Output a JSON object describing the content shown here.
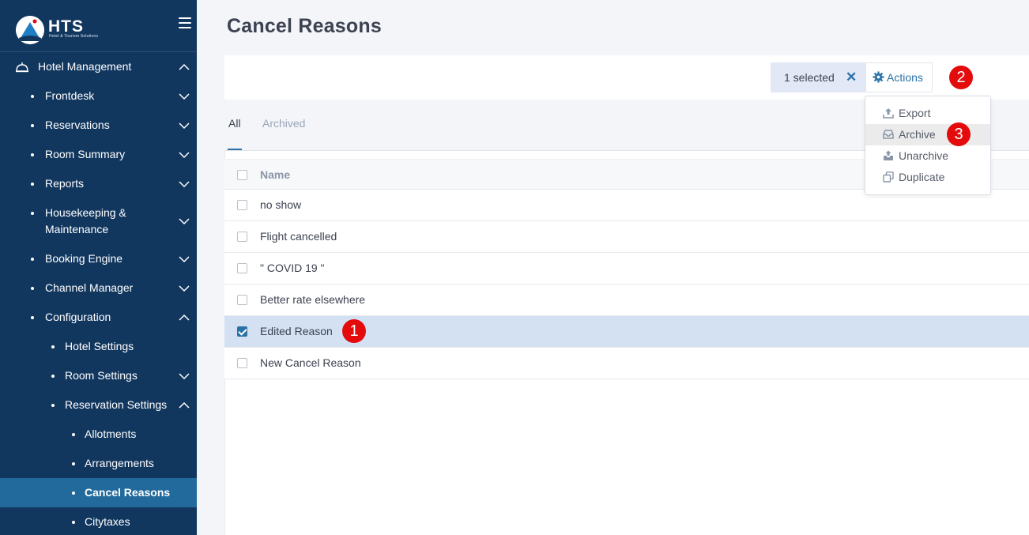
{
  "sidebar": {
    "brand": "HTS",
    "brand_sub": "Hotel & Tourism Solutions",
    "items": [
      {
        "label": "Hotel Management"
      },
      {
        "label": "Frontdesk"
      },
      {
        "label": "Reservations"
      },
      {
        "label": "Room Summary"
      },
      {
        "label": "Reports"
      },
      {
        "label": "Housekeeping &"
      },
      {
        "label": "Maintenance"
      },
      {
        "label": "Booking Engine"
      },
      {
        "label": "Channel Manager"
      },
      {
        "label": "Configuration"
      },
      {
        "label": "Hotel Settings"
      },
      {
        "label": "Room Settings"
      },
      {
        "label": "Reservation Settings"
      },
      {
        "label": "Allotments"
      },
      {
        "label": "Arrangements"
      },
      {
        "label": "Cancel Reasons"
      },
      {
        "label": "Citytaxes"
      }
    ]
  },
  "page": {
    "title": "Cancel Reasons"
  },
  "toolbar": {
    "selected_label": "1 selected",
    "clear_glyph": "✕",
    "actions_label": "Actions"
  },
  "tabs": [
    {
      "label": "All"
    },
    {
      "label": "Archived"
    }
  ],
  "table": {
    "header_name": "Name",
    "rows": [
      {
        "name": "no show"
      },
      {
        "name": "Flight cancelled"
      },
      {
        "name": "\" COVID 19 \""
      },
      {
        "name": "Better rate elsewhere"
      },
      {
        "name": "Edited Reason"
      },
      {
        "name": "New Cancel Reason"
      }
    ]
  },
  "actions_menu": [
    {
      "label": "Export",
      "icon": "upload-icon"
    },
    {
      "label": "Archive",
      "icon": "inbox-icon"
    },
    {
      "label": "Unarchive",
      "icon": "unarchive-icon"
    },
    {
      "label": "Duplicate",
      "icon": "duplicate-icon"
    }
  ],
  "annotations": [
    "1",
    "2",
    "3"
  ],
  "colors": {
    "sidebar_bg": "#12375f",
    "sidebar_active": "#226a9c",
    "accent": "#2b72a8",
    "badge": "#e30b0b",
    "selected_row": "#d3e1f3"
  }
}
